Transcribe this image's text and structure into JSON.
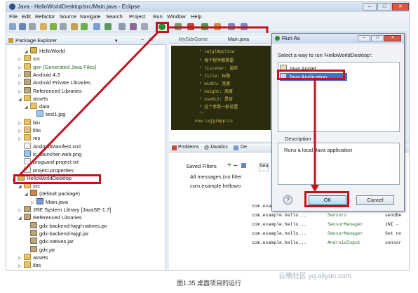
{
  "window": {
    "title": "Java - HelloWorldDesktop/src/Main.java - Eclipse"
  },
  "menu": [
    "File",
    "Edit",
    "Refactor",
    "Source",
    "Navigate",
    "Search",
    "Project",
    "Run",
    "Window",
    "Help"
  ],
  "package_explorer": {
    "title": "Package Explorer",
    "items": [
      {
        "label": "HelloWorld",
        "icon": "project-icon"
      },
      {
        "label": "src",
        "icon": "folder-icon"
      },
      {
        "label": "gen [Generated Java Files]",
        "icon": "folder-icon"
      },
      {
        "label": "Android 4.3",
        "icon": "library-icon"
      },
      {
        "label": "Android Private Libraries",
        "icon": "library-icon"
      },
      {
        "label": "Referenced Libraries",
        "icon": "library-icon"
      },
      {
        "label": "assets",
        "icon": "folder-icon"
      },
      {
        "label": "data",
        "icon": "folder-icon"
      },
      {
        "label": "test1.jpg",
        "icon": "image-icon"
      },
      {
        "label": "bin",
        "icon": "folder-icon"
      },
      {
        "label": "libs",
        "icon": "folder-icon"
      },
      {
        "label": "res",
        "icon": "folder-icon"
      },
      {
        "label": "AndroidManifest.xml",
        "icon": "file-icon"
      },
      {
        "label": "ic_launcher-web.png",
        "icon": "image-icon"
      },
      {
        "label": "proguard-project.txt",
        "icon": "file-icon"
      },
      {
        "label": "project.properties",
        "icon": "file-icon"
      },
      {
        "label": "HelloWorldDesktop",
        "icon": "project-icon"
      },
      {
        "label": "src",
        "icon": "folder-icon"
      },
      {
        "label": "(default package)",
        "icon": "package-icon"
      },
      {
        "label": "Main.java",
        "icon": "java-file-icon"
      },
      {
        "label": "JRE System Library [JavaSE-1.7]",
        "icon": "library-icon"
      },
      {
        "label": "Referenced Libraries",
        "icon": "library-icon"
      },
      {
        "label": "gdx-backend-lwjgl-natives.jar",
        "icon": "jar-icon"
      },
      {
        "label": "gdx-backend-lwjgl.jar",
        "icon": "jar-icon"
      },
      {
        "label": "gdx-natives.jar",
        "icon": "jar-icon"
      },
      {
        "label": "gdx.jar",
        "icon": "jar-icon"
      },
      {
        "label": "assets",
        "icon": "folder-icon"
      },
      {
        "label": "libs",
        "icon": "folder-icon"
      }
    ]
  },
  "editor": {
    "tabs": [
      "MyGdxGame",
      "Main.java"
    ],
    "code": [
      "* LwjglApplica",
      "* 每个程序都需要",
      "* listener: 监听",
      "* title: 标题",
      "* width: 宽度",
      "* height: 高度",
      "* useGL2: 是否",
      "* 这个参数一般设置",
      "*/",
      "new LwjglApplic"
    ]
  },
  "views": {
    "tabs": [
      "Problems",
      "Javadoc",
      "De"
    ]
  },
  "logcat": {
    "saved_filters_label": "Saved Filters",
    "filters": [
      "All messages (no filter",
      "com.example.hellowo"
    ],
    "rows": [
      {
        "app": "com.example.hello...",
        "tag": "Sensors",
        "text": "Remain"
      },
      {
        "app": "com.example.hello...",
        "tag": "Sensors",
        "text": "sendDe"
      },
      {
        "app": "com.example.hello...",
        "tag": "SensorManager",
        "text": "JNI -"
      },
      {
        "app": "com.example.hello...",
        "tag": "SensorManager",
        "text": "Set no"
      },
      {
        "app": "com.example.hello...",
        "tag": "AndroidInput",
        "text": "sensor"
      }
    ]
  },
  "dialog": {
    "title": "Run As",
    "prompt": "Select a way to run 'HelloWorldDesktop':",
    "options": [
      {
        "label": "Java Applet",
        "selected": false
      },
      {
        "label": "Java Application",
        "selected": true
      }
    ],
    "description_label": "Description",
    "description_text": "Runs a local Java application",
    "help_label": "?",
    "ok_label": "OK",
    "cancel_label": "Cancel"
  },
  "caption": "图1.35   桌面项目的运行",
  "watermark": "云栖社区 yq.aliyun.com",
  "colors": {
    "highlight": "#c1121f",
    "selection": "#3875d7"
  }
}
